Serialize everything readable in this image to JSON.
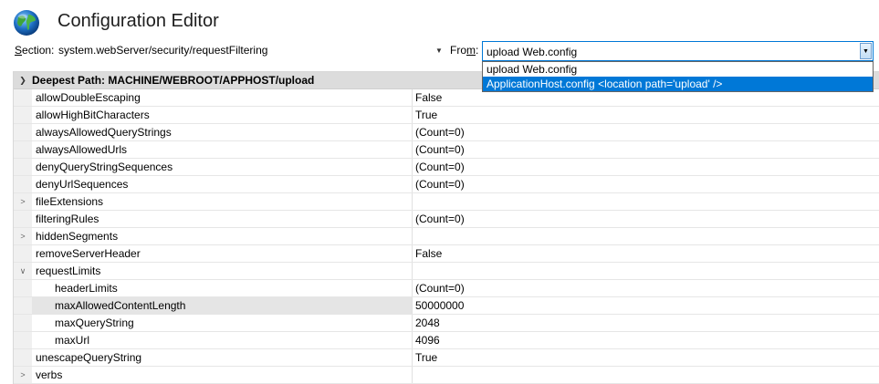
{
  "window": {
    "title": "Configuration Editor"
  },
  "section": {
    "label_prefix": "S",
    "label_rest": "ection:",
    "value": "system.webServer/security/requestFiltering"
  },
  "from": {
    "label_prefix": "Fro",
    "label_underline": "m",
    "label_suffix": ":",
    "value": "upload Web.config"
  },
  "dropdown": {
    "options": [
      "upload Web.config",
      "ApplicationHost.config <location path='upload' />"
    ]
  },
  "grid": {
    "header": "Deepest Path: MACHINE/WEBROOT/APPHOST/upload",
    "rows": [
      {
        "name": "allowDoubleEscaping",
        "value": "False"
      },
      {
        "name": "allowHighBitCharacters",
        "value": "True"
      },
      {
        "name": "alwaysAllowedQueryStrings",
        "value": "(Count=0)"
      },
      {
        "name": "alwaysAllowedUrls",
        "value": "(Count=0)"
      },
      {
        "name": "denyQueryStringSequences",
        "value": "(Count=0)"
      },
      {
        "name": "denyUrlSequences",
        "value": "(Count=0)"
      },
      {
        "name": "fileExtensions",
        "value": ""
      },
      {
        "name": "filteringRules",
        "value": "(Count=0)"
      },
      {
        "name": "hiddenSegments",
        "value": ""
      },
      {
        "name": "removeServerHeader",
        "value": "False"
      },
      {
        "name": "requestLimits",
        "value": ""
      },
      {
        "name": "headerLimits",
        "value": "(Count=0)"
      },
      {
        "name": "maxAllowedContentLength",
        "value": "50000000"
      },
      {
        "name": "maxQueryString",
        "value": "2048"
      },
      {
        "name": "maxUrl",
        "value": "4096"
      },
      {
        "name": "unescapeQueryString",
        "value": "True"
      },
      {
        "name": "verbs",
        "value": ""
      }
    ]
  }
}
